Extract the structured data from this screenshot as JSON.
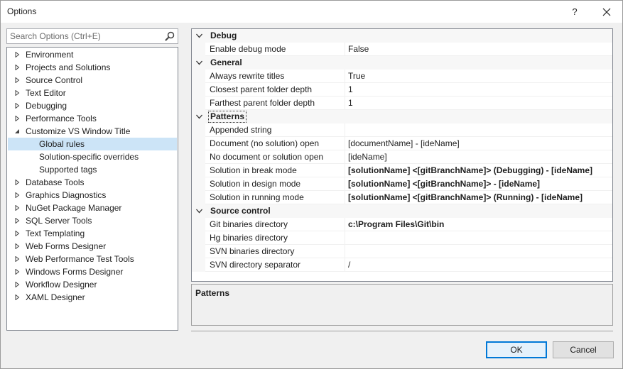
{
  "window": {
    "title": "Options",
    "help_label": "?"
  },
  "search": {
    "placeholder": "Search Options (Ctrl+E)"
  },
  "tree": {
    "items": [
      {
        "label": "Environment",
        "level": 0,
        "state": "collapsed"
      },
      {
        "label": "Projects and Solutions",
        "level": 0,
        "state": "collapsed"
      },
      {
        "label": "Source Control",
        "level": 0,
        "state": "collapsed"
      },
      {
        "label": "Text Editor",
        "level": 0,
        "state": "collapsed"
      },
      {
        "label": "Debugging",
        "level": 0,
        "state": "collapsed"
      },
      {
        "label": "Performance Tools",
        "level": 0,
        "state": "collapsed"
      },
      {
        "label": "Customize VS Window Title",
        "level": 0,
        "state": "expanded"
      },
      {
        "label": "Global rules",
        "level": 1,
        "state": "leaf",
        "selected": true
      },
      {
        "label": "Solution-specific overrides",
        "level": 1,
        "state": "leaf"
      },
      {
        "label": "Supported tags",
        "level": 1,
        "state": "leaf"
      },
      {
        "label": "Database Tools",
        "level": 0,
        "state": "collapsed"
      },
      {
        "label": "Graphics Diagnostics",
        "level": 0,
        "state": "collapsed"
      },
      {
        "label": "NuGet Package Manager",
        "level": 0,
        "state": "collapsed"
      },
      {
        "label": "SQL Server Tools",
        "level": 0,
        "state": "collapsed"
      },
      {
        "label": "Text Templating",
        "level": 0,
        "state": "collapsed"
      },
      {
        "label": "Web Forms Designer",
        "level": 0,
        "state": "collapsed"
      },
      {
        "label": "Web Performance Test Tools",
        "level": 0,
        "state": "collapsed"
      },
      {
        "label": "Windows Forms Designer",
        "level": 0,
        "state": "collapsed"
      },
      {
        "label": "Workflow Designer",
        "level": 0,
        "state": "collapsed"
      },
      {
        "label": "XAML Designer",
        "level": 0,
        "state": "collapsed"
      }
    ]
  },
  "grid": {
    "categories": [
      {
        "label": "Debug",
        "properties": [
          {
            "name": "Enable debug mode",
            "value": "False",
            "bold": false
          }
        ]
      },
      {
        "label": "General",
        "properties": [
          {
            "name": "Always rewrite titles",
            "value": "True",
            "bold": false
          },
          {
            "name": "Closest parent folder depth",
            "value": "1",
            "bold": false
          },
          {
            "name": "Farthest parent folder depth",
            "value": "1",
            "bold": false
          }
        ]
      },
      {
        "label": "Patterns",
        "focused": true,
        "properties": [
          {
            "name": "Appended string",
            "value": "",
            "bold": false
          },
          {
            "name": "Document (no solution) open",
            "value": "[documentName] - [ideName]",
            "bold": false
          },
          {
            "name": "No document or solution open",
            "value": "[ideName]",
            "bold": false
          },
          {
            "name": "Solution in break mode",
            "value": "[solutionName] <[gitBranchName]> (Debugging) - [ideName]",
            "bold": true
          },
          {
            "name": "Solution in design mode",
            "value": "[solutionName] <[gitBranchName]> - [ideName]",
            "bold": true
          },
          {
            "name": "Solution in running mode",
            "value": "[solutionName] <[gitBranchName]> (Running) - [ideName]",
            "bold": true
          }
        ]
      },
      {
        "label": "Source control",
        "properties": [
          {
            "name": "Git binaries directory",
            "value": "c:\\Program Files\\Git\\bin",
            "bold": true
          },
          {
            "name": "Hg binaries directory",
            "value": "",
            "bold": false
          },
          {
            "name": "SVN binaries directory",
            "value": "",
            "bold": false
          },
          {
            "name": "SVN directory separator",
            "value": "/",
            "bold": false
          }
        ]
      }
    ]
  },
  "description": {
    "title": "Patterns"
  },
  "buttons": {
    "ok": "OK",
    "cancel": "Cancel"
  }
}
